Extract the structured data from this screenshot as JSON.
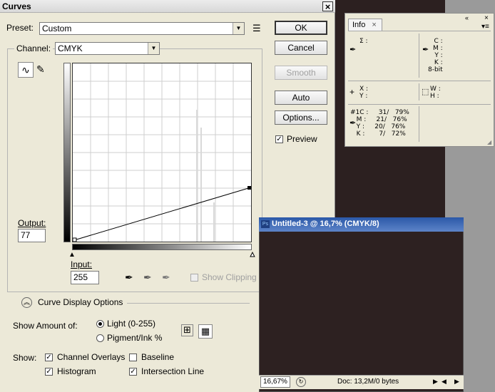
{
  "curves": {
    "title": "Curves",
    "close": "×",
    "preset_label": "Preset:",
    "preset_value": "Custom",
    "channel_label": "Channel:",
    "channel_value": "CMYK",
    "buttons": {
      "ok": "OK",
      "cancel": "Cancel",
      "smooth": "Smooth",
      "auto": "Auto",
      "options": "Options..."
    },
    "preview_label": "Preview",
    "preview_checked": true,
    "output_label": "Output:",
    "output_value": "77",
    "input_label": "Input:",
    "input_value": "255",
    "show_clipping_label": "Show Clipping",
    "display_options_label": "Curve Display Options",
    "show_amount_label": "Show Amount of:",
    "light_label": "Light  (0-255)",
    "pigment_label": "Pigment/Ink %",
    "show_label": "Show:",
    "channel_overlays_label": "Channel Overlays",
    "baseline_label": "Baseline",
    "histogram_label": "Histogram",
    "intersection_label": "Intersection Line",
    "curve_points": [
      [
        0,
        0
      ],
      [
        255,
        77
      ]
    ]
  },
  "info": {
    "tab_label": "Info",
    "tab_close": "×",
    "sigma": "Σ :",
    "cmyk_labels": "C :\nM :\nY :\nK :\n8-bit",
    "xy_labels": "X :\nY :",
    "wh_labels": "W :\nH :",
    "sample": "#1C :     31/   79%\n   M :     21/   76%\n   Y :     20/   76%\n   K :       7/   72%"
  },
  "document": {
    "title": "Untitled-3 @ 16,7% (CMYK/8)",
    "zoom": "16,67%",
    "doc_size": "Doc: 13,2M/0 bytes"
  }
}
